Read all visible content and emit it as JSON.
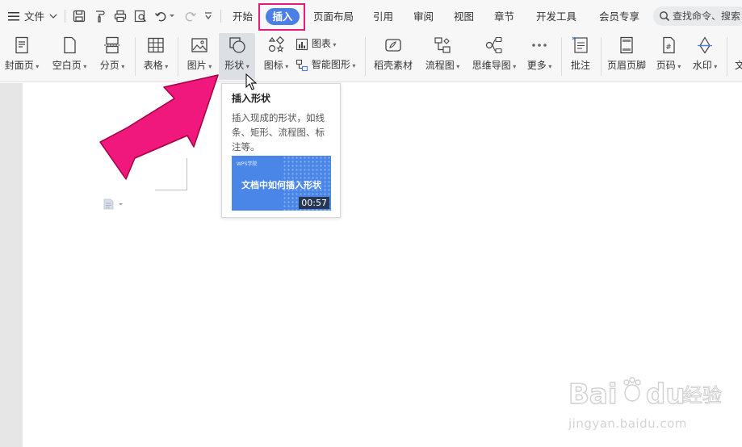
{
  "menubar": {
    "file_label": "文件",
    "tabs": [
      {
        "label": "开始"
      },
      {
        "label": "插入",
        "active": true
      },
      {
        "label": "页面布局"
      },
      {
        "label": "引用"
      },
      {
        "label": "审阅"
      },
      {
        "label": "视图"
      },
      {
        "label": "章节"
      },
      {
        "label": "开发工具"
      },
      {
        "label": "会员专享"
      }
    ],
    "search_placeholder": "查找命令、搜索"
  },
  "ribbon": {
    "cover_page": "封面页",
    "blank_page": "空白页",
    "page_break": "分页",
    "table": "表格",
    "picture": "图片",
    "shape": "形状",
    "icons": "图标",
    "chart": "图表",
    "smart_art": "智能图形",
    "stock_material": "稻壳素材",
    "flowchart": "流程图",
    "mind_map": "思维导图",
    "more": "更多",
    "comment": "批注",
    "header_footer": "页眉页脚",
    "page_number": "页码",
    "watermark": "水印",
    "text_partial": "文"
  },
  "tooltip": {
    "title": "插入形状",
    "description": "插入现成的形状，如线条、矩形、流程图、标注等。",
    "thumbnail_brand": "WPS学院",
    "thumbnail_text": "文档中如何插入形状",
    "duration": "00:57"
  },
  "watermark": {
    "logo": "Baidu经验",
    "url": "jingyan.baidu.com"
  },
  "colors": {
    "accent_tab": "#4a7fe6",
    "highlight_box": "#e8197a",
    "arrow": "#f0187c"
  }
}
